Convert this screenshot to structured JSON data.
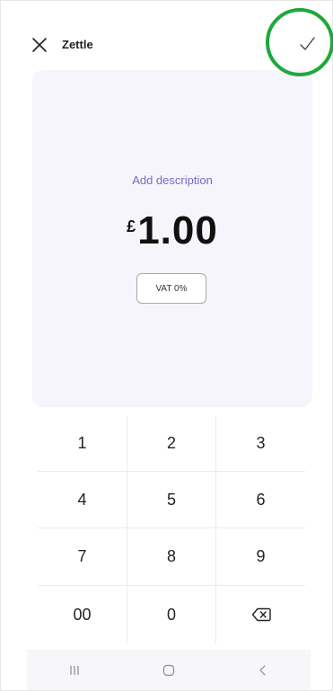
{
  "header": {
    "title": "Zettle",
    "close_icon": "close-icon",
    "confirm_icon": "checkmark-icon",
    "highlight_color": "#1ea83c"
  },
  "entry": {
    "description_placeholder": "Add description",
    "currency_symbol": "£",
    "amount": "1.00",
    "vat_label": "VAT 0%",
    "accent_color": "#7b69c2"
  },
  "keypad": {
    "keys": [
      "1",
      "2",
      "3",
      "4",
      "5",
      "6",
      "7",
      "8",
      "9",
      "00",
      "0"
    ],
    "backspace_icon": "backspace-icon"
  },
  "system_nav": {
    "recents_icon": "recents-icon",
    "home_icon": "home-icon",
    "back_icon": "back-icon"
  }
}
